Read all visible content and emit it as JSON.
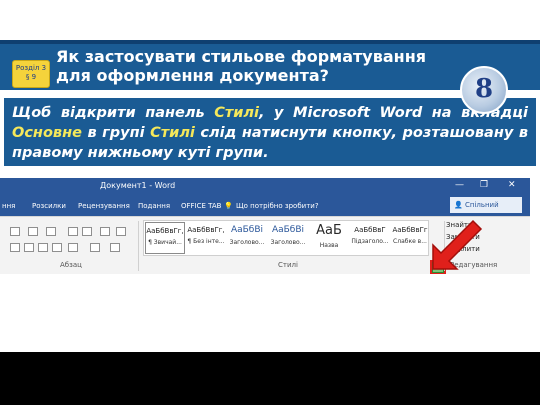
{
  "slide": {
    "section_badge_line1": "Розділ 3",
    "section_badge_line2": "§ 9",
    "title_line1": "Як застосувати стильове форматування",
    "title_line2": "для оформлення документа?",
    "grade": "8",
    "instruction": {
      "p1": "Щоб відкрити панель ",
      "h1": "Стилі",
      "p2": ", у Microsoft Word на вкладці ",
      "h2": "Основне",
      "p3": " в групі ",
      "h3": "Стилі",
      "p4": " слід натиснути кнопку, розташовану в правому нижньому куті групи."
    }
  },
  "word": {
    "window_title": "Документ1 - Word",
    "minimize_glyph": "—",
    "restore_glyph": "❐",
    "close_glyph": "✕",
    "tabs": [
      "ння",
      "Розсилки",
      "Рецензування",
      "Подання",
      "OFFICE TAB"
    ],
    "tell_me": "Що потрібно зробити?",
    "share": "Спільний доступ",
    "groups": {
      "paragraph": "Абзац",
      "styles": "Стилі",
      "editing": "Редагування"
    },
    "styles": [
      {
        "sample": "АаБбВвГг,",
        "name": "¶ Звичай..."
      },
      {
        "sample": "АаБбВвГг,",
        "name": "¶ Без інте..."
      },
      {
        "sample": "АаБбВі",
        "name": "Заголово..."
      },
      {
        "sample": "АаБбВі",
        "name": "Заголово..."
      },
      {
        "sample": "АаБ",
        "name": "Назва"
      },
      {
        "sample": "АаБбВвГ",
        "name": "Підзаголо..."
      },
      {
        "sample": "АаБбВвГг",
        "name": "Слабке в..."
      }
    ],
    "editing_items": [
      "Знайти",
      "Замінити",
      "Виділити"
    ]
  },
  "colors": {
    "header_blue": "#1a5b94",
    "highlight": "#f5e85a",
    "word_blue": "#2b579a",
    "arrow_red": "#e0201b"
  }
}
